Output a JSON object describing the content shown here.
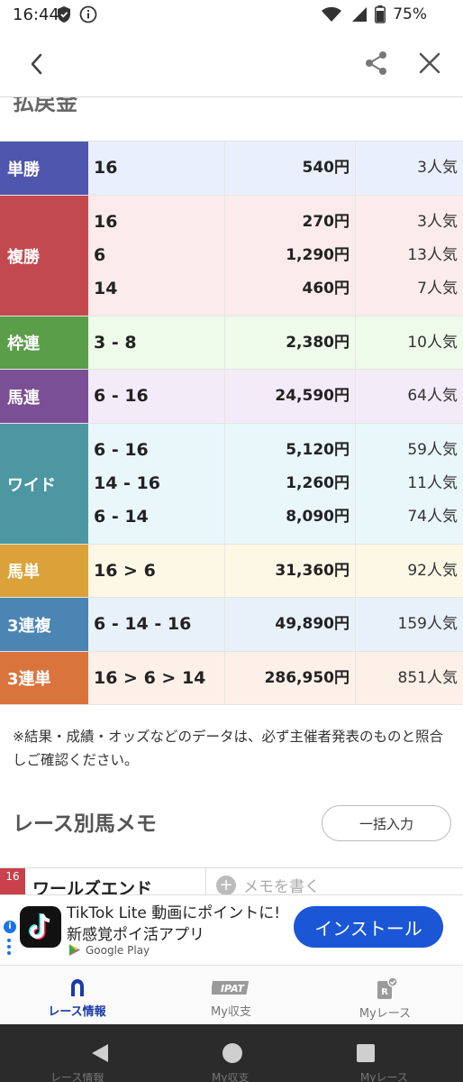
{
  "status_bar": {
    "time": "16:44",
    "battery": "75%"
  },
  "section_title": "払戻金",
  "payout_rows": [
    {
      "bet_type": "単勝",
      "color": "#4f56ad",
      "bg": "#eaf0fb",
      "height": 60,
      "lines": [
        {
          "combo": "16",
          "amount": "540円",
          "popularity": "3人気"
        }
      ]
    },
    {
      "bet_type": "複勝",
      "color": "#c24a4f",
      "bg": "#fbeceb",
      "height": 134,
      "lines": [
        {
          "combo": "16",
          "amount": "270円",
          "popularity": "3人気"
        },
        {
          "combo": "6",
          "amount": "1,290円",
          "popularity": "13人気"
        },
        {
          "combo": "14",
          "amount": "460円",
          "popularity": "7人気"
        }
      ]
    },
    {
      "bet_type": "枠連",
      "color": "#5a9e49",
      "bg": "#eefaea",
      "height": 59,
      "lines": [
        {
          "combo": "3 - 8",
          "amount": "2,380円",
          "popularity": "10人気"
        }
      ]
    },
    {
      "bet_type": "馬連",
      "color": "#7b4f96",
      "bg": "#f4ebf8",
      "height": 60,
      "lines": [
        {
          "combo": "6 - 16",
          "amount": "24,590円",
          "popularity": "64人気"
        }
      ]
    },
    {
      "bet_type": "ワイド",
      "color": "#4c97a2",
      "bg": "#e9f7fb",
      "height": 134,
      "lines": [
        {
          "combo": "6 - 16",
          "amount": "5,120円",
          "popularity": "59人気"
        },
        {
          "combo": "14 - 16",
          "amount": "1,260円",
          "popularity": "11人気"
        },
        {
          "combo": "6 - 14",
          "amount": "8,090円",
          "popularity": "74人気"
        }
      ]
    },
    {
      "bet_type": "馬単",
      "color": "#dba23a",
      "bg": "#fdf8e6",
      "height": 59,
      "lines": [
        {
          "combo": "16 > 6",
          "amount": "31,360円",
          "popularity": "92人気"
        }
      ]
    },
    {
      "bet_type": "3連複",
      "color": "#4b85b3",
      "bg": "#e8f1fa",
      "height": 60,
      "lines": [
        {
          "combo": "6 - 14 - 16",
          "amount": "49,890円",
          "popularity": "159人気"
        }
      ]
    },
    {
      "bet_type": "3連単",
      "color": "#d9743d",
      "bg": "#fcf0e8",
      "height": 59,
      "lines": [
        {
          "combo": "16 > 6 > 14",
          "amount": "286,950円",
          "popularity": "851人気"
        }
      ]
    }
  ],
  "note": "※結果・成績・オッズなどのデータは、必ず主催者発表のものと照合しご確認ください。",
  "memo": {
    "title": "レース別馬メモ",
    "bulk_button": "一括入力",
    "first_horse_number": "16",
    "first_horse_name": "ワールズエンド",
    "write_placeholder": "メモを書く"
  },
  "ad": {
    "title": "TikTok Lite 動画にポイントに!",
    "subtitle": "新感覚ポイ活アプリ",
    "store": "Google Play",
    "install": "インストール"
  },
  "bottom_nav": {
    "items": [
      {
        "label": "レース情報",
        "active": true
      },
      {
        "label": "My収支",
        "active": false,
        "badge": "IPAT"
      },
      {
        "label": "Myレース",
        "active": false,
        "badge": "R"
      }
    ]
  },
  "icons": {
    "back": "chevron-left-icon",
    "share": "share-icon",
    "close": "close-icon"
  }
}
